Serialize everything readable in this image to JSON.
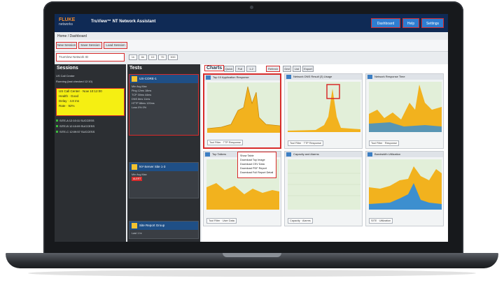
{
  "app": {
    "logo_main": "FLUKE",
    "logo_sub": "networks",
    "title": "TruView™ NT Network Assistant"
  },
  "header_buttons": [
    {
      "label": "Dashboard"
    },
    {
      "label": "Help"
    },
    {
      "label": "Settings"
    }
  ],
  "breadcrumb": "Home / Dashboard",
  "subnav": [
    "New Session",
    "Save Session",
    "Load Session"
  ],
  "filter": {
    "placeholder": "TrueView Network ID"
  },
  "ranges": [
    "1h",
    "6h",
    "1D",
    "7D",
    "30D"
  ],
  "sessions": {
    "title": "Sessions",
    "rows": [
      "US Call Center",
      "Running  (last checked 12:10)"
    ],
    "card": [
      "US Call Center  ·  Now 10:12:00",
      "Health  ·  Good",
      "Delay  ·  4.8 ms",
      "Rate  ·  92%"
    ],
    "green_rows": [
      "SITE-A    12:10:11 SUCCESS",
      "SITE-B    12:10:09 SUCCESS",
      "SITE-C    12:09:57 SUCCESS"
    ]
  },
  "tests": {
    "title": "Tests",
    "cards": [
      {
        "title": "US-CORE-1",
        "stats": [
          "Min   Avg   Max",
          "Ping    12ms  18ms",
          "TCP     30ms  44ms",
          "DNS     8ms   11ms",
          "HTTP    88ms  120ms",
          "Loss    0%    0%"
        ]
      },
      {
        "title": "NY-Server Site 1-3",
        "stats": [
          "Min   Avg   Max"
        ],
        "badge": "ALERT"
      },
      {
        "title": "Site Report Group",
        "stats": [
          "Last 1 hr"
        ]
      }
    ]
  },
  "charts": {
    "title": "Charts",
    "tabs": [
      "Quick",
      "Full",
      "1-2",
      "Refresh",
      "Grid",
      "List",
      "Export"
    ],
    "tiles": [
      {
        "title": "Top 10 Application Response",
        "foot": "Tool Filter  ·  TTP Response"
      },
      {
        "title": "Network DNS Result (3)  Usage",
        "foot": "Tool Filter  ·  TTP Response"
      },
      {
        "title": "Network Response Time",
        "foot": "Tool Filter  ·  Response"
      },
      {
        "title": "Top Talkers",
        "foot": "Tool Filter  ·  User Data"
      },
      {
        "title": "Capacity and Alarms",
        "foot": "Capacity  ·  Alarms"
      },
      {
        "title": "Bandwidth Utilization",
        "foot": "SITE  ·  Utilization"
      }
    ],
    "popup": [
      "Show Table",
      "Download Top Image",
      "Download CSV Data",
      "Download PDF Report",
      "Download Full Report Detail"
    ]
  },
  "colors": {
    "header": "#0f2a55",
    "accent": "#2e7dd1",
    "highlight": "#d82b2b",
    "session_card": "#f5ef12",
    "area_fill": "#f2b21e",
    "plot_bg": "#e2efd9",
    "secondary_fill": "#3d8fcf"
  }
}
